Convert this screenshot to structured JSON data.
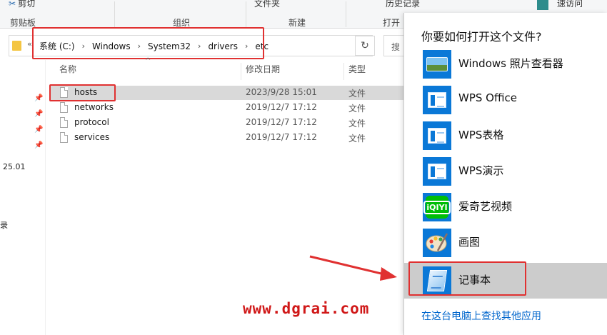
{
  "ribbon": {
    "cut_label": "剪切",
    "clipboard_group": "剪贴板",
    "new_folder_label": "文件夹",
    "history_label": "历史记录",
    "easy_access_label": "速访问",
    "organize_group": "组织",
    "new_group": "新建",
    "open_group": "打开"
  },
  "address_bar": {
    "back_chevron": "«",
    "crumbs": [
      "系统 (C:)",
      "Windows",
      "System32",
      "drivers",
      "etc"
    ],
    "refresh_icon": "↻",
    "search_placeholder": "搜"
  },
  "nav_pane": {
    "partial_text_1": "25.01",
    "partial_text_2": "录"
  },
  "file_list": {
    "columns": {
      "name": "名称",
      "date": "修改日期",
      "type": "类型"
    },
    "rows": [
      {
        "name": "hosts",
        "date": "2023/9/28 15:01",
        "type": "文件"
      },
      {
        "name": "networks",
        "date": "2019/12/7 17:12",
        "type": "文件"
      },
      {
        "name": "protocol",
        "date": "2019/12/7 17:12",
        "type": "文件"
      },
      {
        "name": "services",
        "date": "2019/12/7 17:12",
        "type": "文件"
      }
    ]
  },
  "open_with": {
    "title": "你要如何打开这个文件?",
    "apps": [
      {
        "name": "Windows 照片查看器",
        "icon": "photo-viewer-icon"
      },
      {
        "name": "WPS Office",
        "icon": "wps-office-icon"
      },
      {
        "name": "WPS表格",
        "icon": "wps-spreadsheet-icon"
      },
      {
        "name": "WPS演示",
        "icon": "wps-presentation-icon"
      },
      {
        "name": "爱奇艺视频",
        "icon": "iqiyi-icon"
      },
      {
        "name": "画图",
        "icon": "paint-icon"
      },
      {
        "name": "记事本",
        "icon": "notepad-icon"
      }
    ],
    "iqiyi_logo_text": "iQIYI",
    "more_apps_link": "在这台电脑上查找其他应用"
  },
  "watermark": "www.dgrai.com",
  "colors": {
    "accent_blue": "#0a78d7",
    "highlight_red": "#e03131",
    "selection_gray": "#d9d9d9",
    "link_blue": "#0066cc"
  }
}
